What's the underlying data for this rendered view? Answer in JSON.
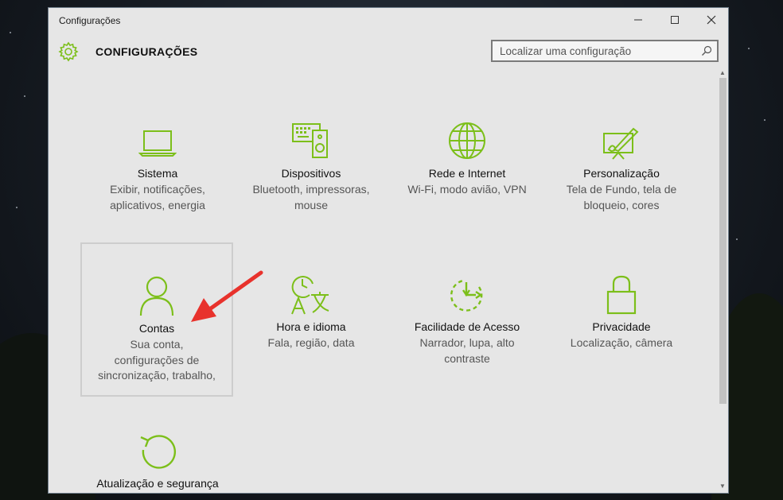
{
  "window": {
    "title": "Configurações",
    "controls": {
      "minimize": "minimize-icon",
      "maximize": "maximize-icon",
      "close": "close-icon"
    }
  },
  "header": {
    "title": "CONFIGURAÇÕES",
    "icon": "gear-icon"
  },
  "search": {
    "placeholder": "Localizar uma configuração",
    "icon": "search-icon"
  },
  "accent_color": "#7cbf1a",
  "annotation_color": "#e8322c",
  "tiles": [
    {
      "name": "Sistema",
      "desc1": "Exibir, notificações,",
      "desc2": "aplicativos, energia",
      "desc3": "",
      "icon": "laptop-icon"
    },
    {
      "name": "Dispositivos",
      "desc1": "Bluetooth, impressoras,",
      "desc2": "mouse",
      "desc3": "",
      "icon": "keyboard-speaker-icon"
    },
    {
      "name": "Rede e Internet",
      "desc1": "Wi-Fi, modo avião, VPN",
      "desc2": "",
      "desc3": "",
      "icon": "globe-icon"
    },
    {
      "name": "Personalização",
      "desc1": "Tela de Fundo, tela de",
      "desc2": "bloqueio, cores",
      "desc3": "",
      "icon": "paint-monitor-icon"
    },
    {
      "name": "Contas",
      "desc1": "Sua conta,",
      "desc2": "configurações de",
      "desc3": "sincronização, trabalho,",
      "icon": "person-icon"
    },
    {
      "name": "Hora e idioma",
      "desc1": "Fala, região, data",
      "desc2": "",
      "desc3": "",
      "icon": "clock-language-icon"
    },
    {
      "name": "Facilidade de Acesso",
      "desc1": "Narrador, lupa, alto",
      "desc2": "contraste",
      "desc3": "",
      "icon": "accessibility-clock-icon"
    },
    {
      "name": "Privacidade",
      "desc1": "Localização, câmera",
      "desc2": "",
      "desc3": "",
      "icon": "lock-icon"
    },
    {
      "name": "Atualização e segurança",
      "desc1": "",
      "desc2": "",
      "desc3": "",
      "icon": "refresh-icon"
    }
  ]
}
